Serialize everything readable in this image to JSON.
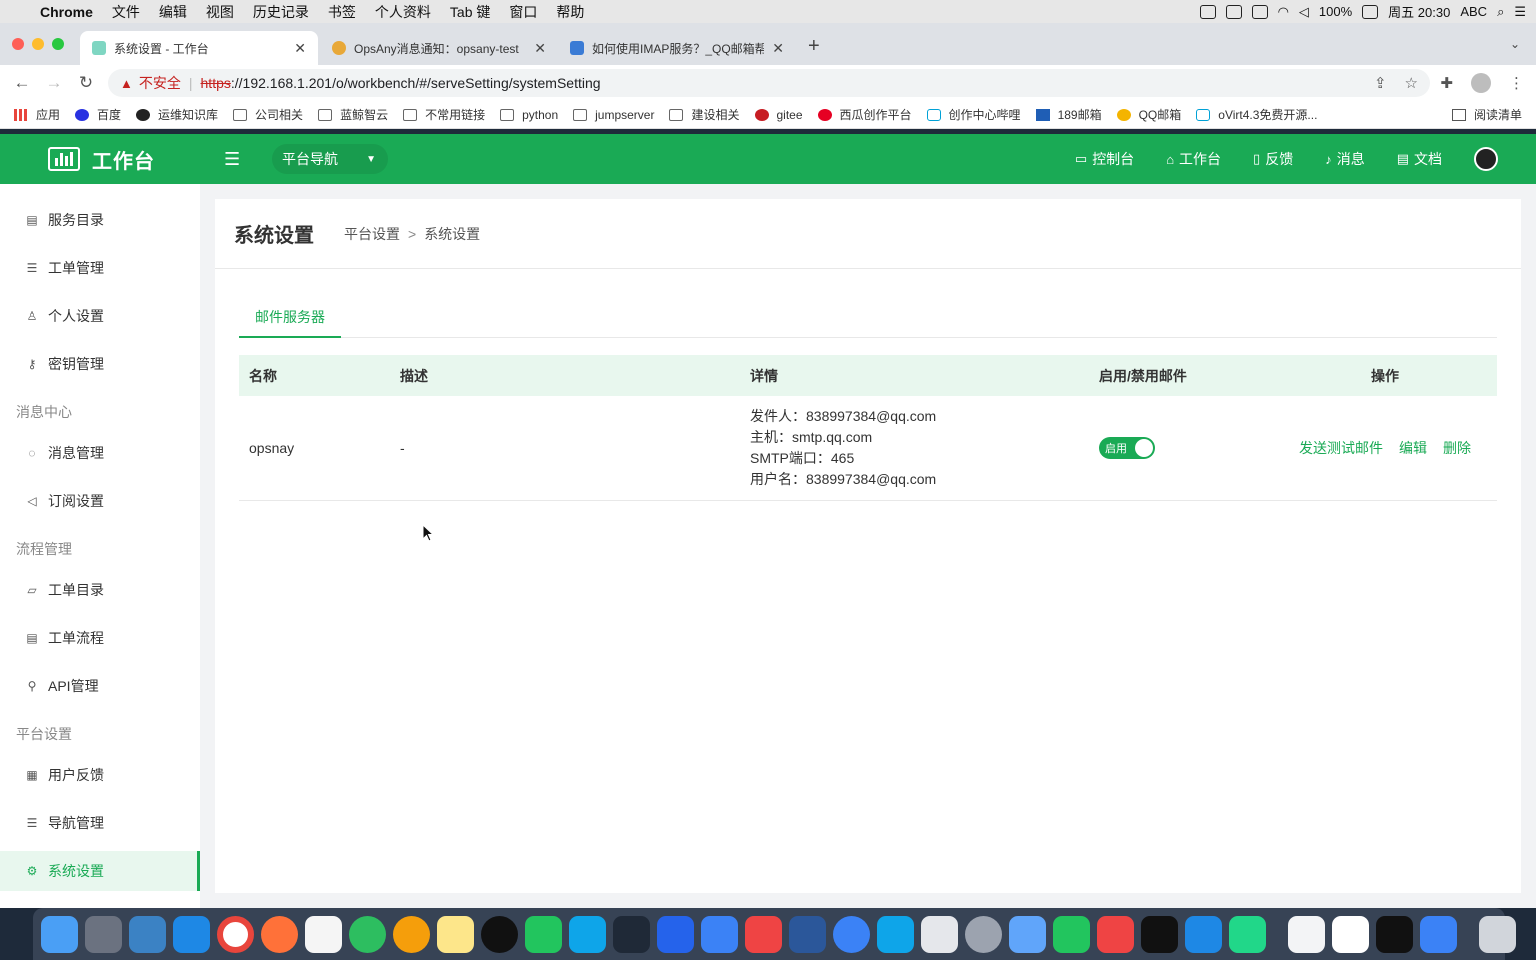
{
  "menubar": {
    "app": "Chrome",
    "items": [
      "文件",
      "编辑",
      "视图",
      "历史记录",
      "书签",
      "个人资料",
      "Tab 键",
      "窗口",
      "帮助"
    ],
    "battery": "100%",
    "clock": "周五 20:30",
    "input_method": "ABC"
  },
  "browser": {
    "tabs": [
      {
        "title": "系统设置 - 工作台",
        "active": true
      },
      {
        "title": "OpsAny消息通知：opsany-test",
        "active": false
      },
      {
        "title": "如何使用IMAP服务？_QQ邮箱帮",
        "active": false
      }
    ],
    "new_tab": "+",
    "security_label": "不安全",
    "url_scheme": "https",
    "url_rest": "://192.168.1.201/o/workbench/#/serveSetting/systemSetting",
    "bookmarks": [
      "应用",
      "百度",
      "运维知识库",
      "公司相关",
      "蓝鲸智云",
      "不常用链接",
      "python",
      "jumpserver",
      "建设相关",
      "gitee",
      "西瓜创作平台",
      "创作中心哔哩",
      "189邮箱",
      "QQ邮箱",
      "oVirt4.3免费开源..."
    ],
    "reading_list": "阅读清单"
  },
  "app": {
    "logo_text": "工作台",
    "platform_nav": "平台导航",
    "top_links": [
      {
        "label": "控制台",
        "icon": "monitor-icon"
      },
      {
        "label": "工作台",
        "icon": "home-icon"
      },
      {
        "label": "反馈",
        "icon": "feedback-icon"
      },
      {
        "label": "消息",
        "icon": "bell-icon"
      },
      {
        "label": "文档",
        "icon": "document-icon"
      }
    ],
    "brand_color": "#1aaa55"
  },
  "sidebar": {
    "items": [
      {
        "label": "服务目录"
      },
      {
        "label": "工单管理"
      },
      {
        "label": "个人设置"
      },
      {
        "label": "密钥管理"
      }
    ],
    "groups": [
      {
        "title": "消息中心",
        "items": [
          {
            "label": "消息管理"
          },
          {
            "label": "订阅设置"
          }
        ]
      },
      {
        "title": "流程管理",
        "items": [
          {
            "label": "工单目录"
          },
          {
            "label": "工单流程"
          },
          {
            "label": "API管理"
          }
        ]
      },
      {
        "title": "平台设置",
        "items": [
          {
            "label": "用户反馈"
          },
          {
            "label": "导航管理"
          },
          {
            "label": "系统设置"
          }
        ]
      }
    ]
  },
  "page": {
    "title": "系统设置",
    "breadcrumb": [
      "平台设置",
      "系统设置"
    ],
    "breadcrumb_sep": ">",
    "tab": "邮件服务器"
  },
  "table": {
    "headers": [
      "名称",
      "描述",
      "详情",
      "启用/禁用邮件",
      "操作"
    ],
    "rows": [
      {
        "name": "opsnay",
        "description": "-",
        "details": [
          "发件人：838997384@qq.com",
          "主机：smtp.qq.com",
          "SMTP端口：465",
          "用户名：838997384@qq.com"
        ],
        "switch_label": "启用",
        "enabled": true,
        "actions": [
          "发送测试邮件",
          "编辑",
          "删除"
        ]
      }
    ]
  }
}
